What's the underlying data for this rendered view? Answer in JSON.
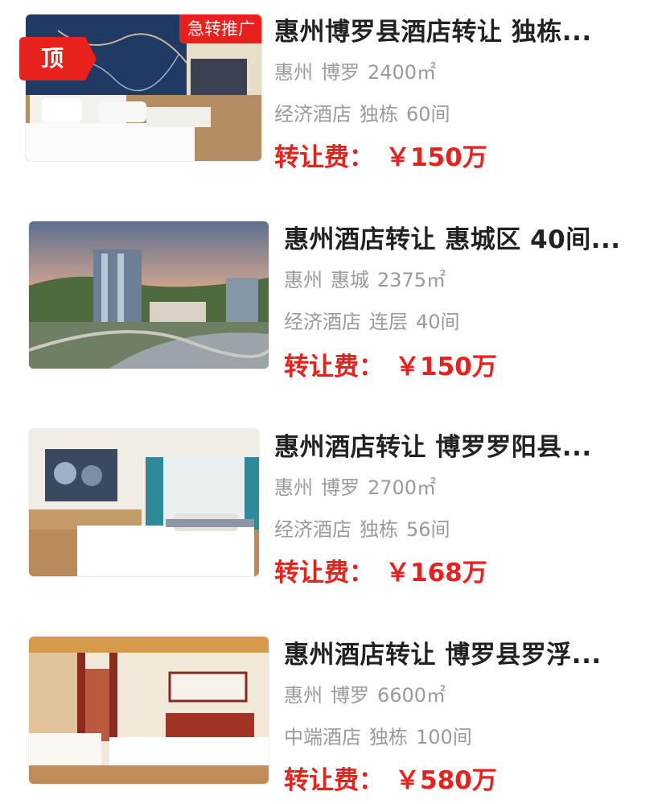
{
  "listings": [
    {
      "title": "惠州博罗县酒店转让 独栋...",
      "city": "惠州",
      "district": "博罗",
      "area": "2400㎡",
      "hotel_type": "经济酒店",
      "building": "独栋",
      "rooms": "60间",
      "price_label": "转让费：",
      "price_value": "￥150万",
      "badge_urgent": "急转推广",
      "badge_top": "顶"
    },
    {
      "title": "惠州酒店转让 惠城区 40间...",
      "city": "惠州",
      "district": "惠城",
      "area": "2375㎡",
      "hotel_type": "经济酒店",
      "building": "连层",
      "rooms": "40间",
      "price_label": "转让费：",
      "price_value": "￥150万"
    },
    {
      "title": "惠州酒店转让 博罗罗阳县...",
      "city": "惠州",
      "district": "博罗",
      "area": "2700㎡",
      "hotel_type": "经济酒店",
      "building": "独栋",
      "rooms": "56间",
      "price_label": "转让费：",
      "price_value": "￥168万"
    },
    {
      "title": "惠州酒店转让 博罗县罗浮...",
      "city": "惠州",
      "district": "博罗",
      "area": "6600㎡",
      "hotel_type": "中端酒店",
      "building": "独栋",
      "rooms": "100间",
      "price_label": "转让费：",
      "price_value": "￥580万"
    }
  ],
  "colors": {
    "price_red": "#e8211d",
    "title_dark": "#222222",
    "meta_gray": "#9a9a9a"
  }
}
